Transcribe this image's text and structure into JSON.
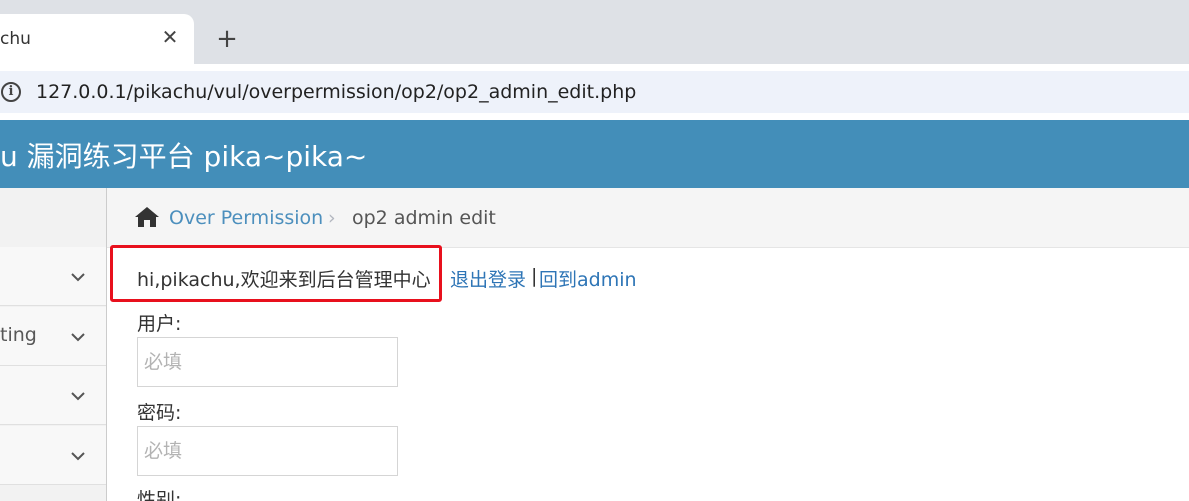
{
  "browser": {
    "tab_title": "chu",
    "tab_close": "✕",
    "new_tab": "+",
    "url": "127.0.0.1/pikachu/vul/overpermission/op2/op2_admin_edit.php"
  },
  "header": {
    "brand": "u 漏洞练习平台 pika~pika~"
  },
  "sidebar": {
    "items": [
      {
        "label": ""
      },
      {
        "label": "ting"
      },
      {
        "label": ""
      },
      {
        "label": ""
      }
    ]
  },
  "breadcrumb": {
    "link": "Over Permission",
    "separator": "›",
    "current": "op2 admin edit"
  },
  "main": {
    "welcome": "hi,pikachu,欢迎来到后台管理中心",
    "logout": "退出登录",
    "pipe": "|",
    "back_admin": "回到admin",
    "form": {
      "username_label": "用户:",
      "username_placeholder": "必填",
      "password_label": "密码:",
      "password_placeholder": "必填",
      "gender_label": "性别:"
    }
  },
  "colors": {
    "header_bg": "#438eb9",
    "link": "#4c8fbd",
    "highlight_box": "#e8101d"
  }
}
